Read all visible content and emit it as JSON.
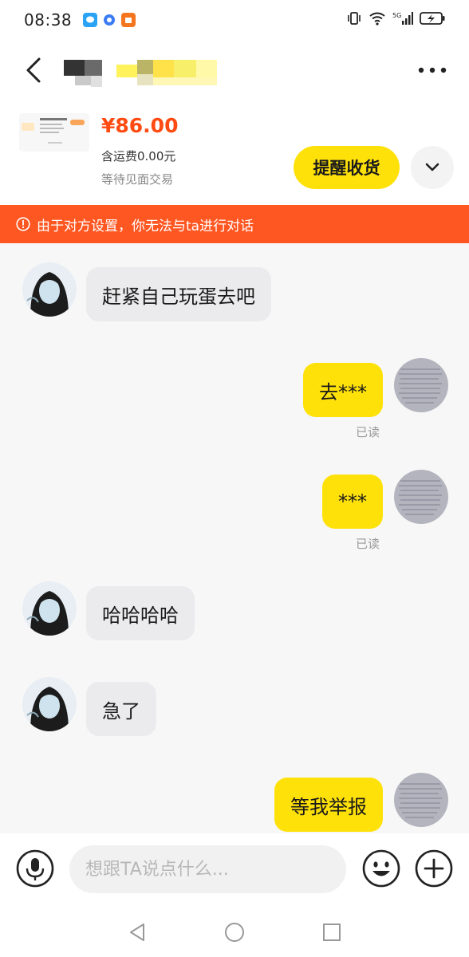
{
  "status_bar": {
    "time": "08:38"
  },
  "order": {
    "price": "¥86.00",
    "shipping": "含运费0.00元",
    "status": "等待见面交易",
    "remind_label": "提醒收货"
  },
  "warning": {
    "text": "由于对方设置，你无法与ta进行对话"
  },
  "messages": [
    {
      "side": "in",
      "text": "赶紧自己玩蛋去吧"
    },
    {
      "side": "out",
      "text": "去***",
      "read": "已读"
    },
    {
      "side": "out",
      "text": "***",
      "read": "已读"
    },
    {
      "side": "in",
      "text": "哈哈哈哈"
    },
    {
      "side": "in",
      "text": "急了"
    },
    {
      "side": "out",
      "text": "等我举报"
    }
  ],
  "input": {
    "placeholder": "想跟TA说点什么..."
  },
  "colors": {
    "accent_yellow": "#ffe10a",
    "warning_orange": "#ff5722",
    "price_orange": "#ff4b12"
  },
  "icons": {
    "back": "chevron-left-icon",
    "more": "more-horizontal-icon",
    "expand": "chevron-down-icon",
    "warning": "exclamation-circle-icon",
    "voice": "microphone-icon",
    "emoji": "smile-icon",
    "plus": "plus-circle-icon"
  }
}
